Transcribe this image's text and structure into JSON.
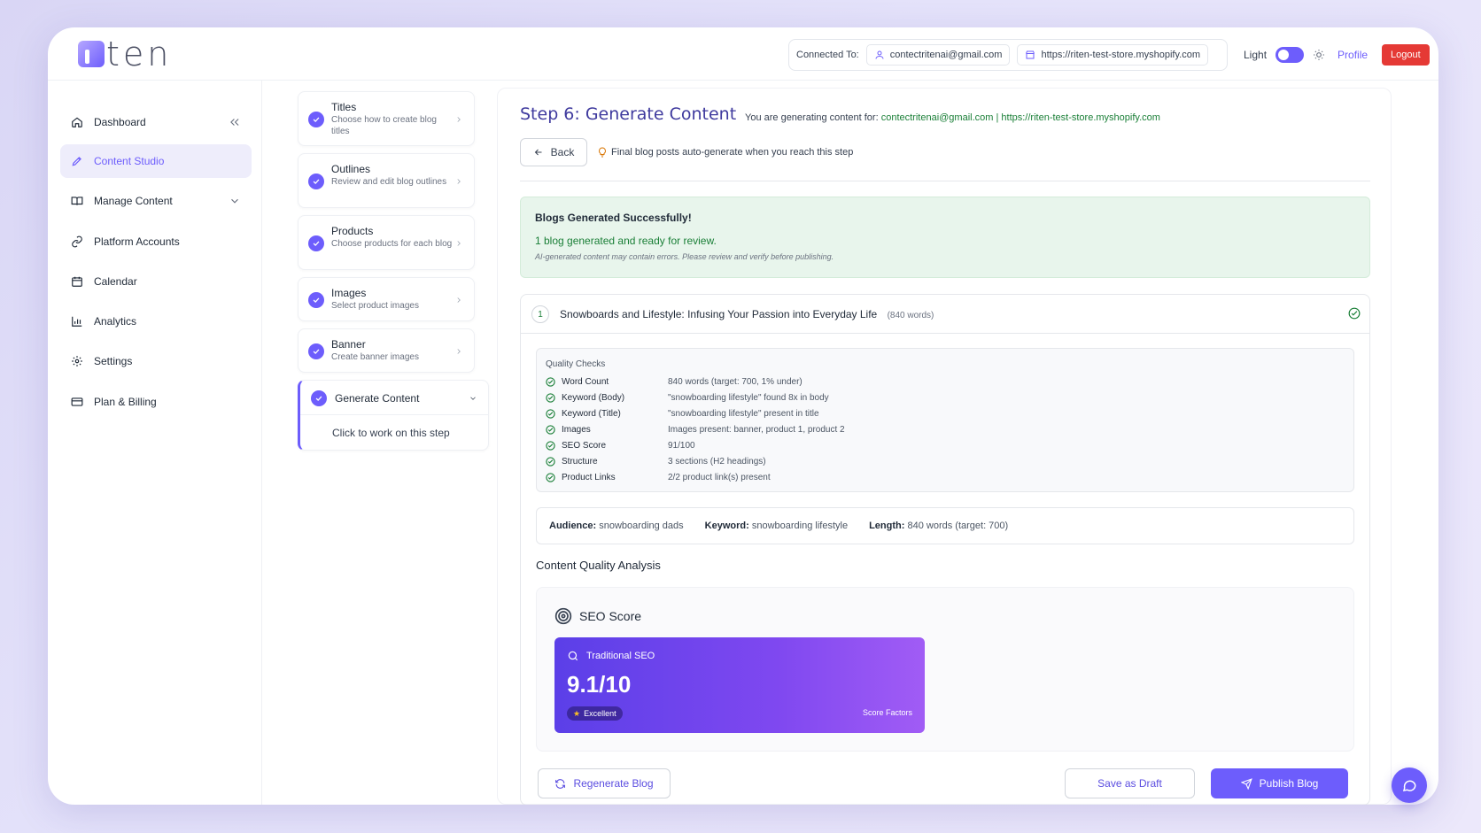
{
  "header": {
    "logo_text": "ten",
    "connected_label": "Connected To:",
    "email": "contectritenai@gmail.com",
    "store_url": "https://riten-test-store.myshopify.com",
    "theme_label": "Light",
    "profile_label": "Profile",
    "logout_label": "Logout"
  },
  "sidebar": {
    "items": [
      {
        "label": "Dashboard",
        "icon": "home-icon"
      },
      {
        "label": "Content Studio",
        "icon": "pen-icon"
      },
      {
        "label": "Manage Content",
        "icon": "book-icon"
      },
      {
        "label": "Platform Accounts",
        "icon": "link-icon"
      },
      {
        "label": "Calendar",
        "icon": "calendar-icon"
      },
      {
        "label": "Analytics",
        "icon": "chart-icon"
      },
      {
        "label": "Settings",
        "icon": "gear-icon"
      },
      {
        "label": "Plan & Billing",
        "icon": "card-icon"
      }
    ]
  },
  "steps": [
    {
      "title": "Titles",
      "desc": "Choose how to create blog titles"
    },
    {
      "title": "Outlines",
      "desc": "Review and edit blog outlines"
    },
    {
      "title": "Products",
      "desc": "Choose products for each blog"
    },
    {
      "title": "Images",
      "desc": "Select product images"
    },
    {
      "title": "Banner",
      "desc": "Create banner images"
    },
    {
      "title": "Generate Content",
      "desc": "Click to work on this step"
    }
  ],
  "main": {
    "title": "Step 6: Generate Content",
    "gen_for_prefix": "You are generating content for:",
    "gen_for_value": "contectritenai@gmail.com | https://riten-test-store.myshopify.com",
    "back_label": "Back",
    "hint": "Final blog posts auto-generate when you reach this step",
    "success_title": "Blogs Generated Successfully!",
    "success_text": "1 blog generated and ready for review.",
    "success_note": "AI-generated content may contain errors. Please review and verify before publishing.",
    "blog": {
      "number": "1",
      "title": "Snowboards and Lifestyle: Infusing Your Passion into Everyday Life",
      "words": "(840 words)"
    },
    "quality_checks_title": "Quality Checks",
    "quality_checks": [
      {
        "label": "Word Count",
        "value": "840 words (target: 700, 1% under)"
      },
      {
        "label": "Keyword (Body)",
        "value": "\"snowboarding lifestyle\" found 8x in body"
      },
      {
        "label": "Keyword (Title)",
        "value": "\"snowboarding lifestyle\" present in title"
      },
      {
        "label": "Images",
        "value": "Images present: banner, product 1, product 2"
      },
      {
        "label": "SEO Score",
        "value": "91/100"
      },
      {
        "label": "Structure",
        "value": "3 sections (H2 headings)"
      },
      {
        "label": "Product Links",
        "value": "2/2 product link(s) present"
      }
    ],
    "meta": {
      "audience_label": "Audience:",
      "audience_value": "snowboarding dads",
      "keyword_label": "Keyword:",
      "keyword_value": "snowboarding lifestyle",
      "length_label": "Length:",
      "length_value": "840 words (target: 700)"
    },
    "cqa_title": "Content Quality Analysis",
    "seo": {
      "title": "SEO Score",
      "card_title": "Traditional SEO",
      "score": "9.1/10",
      "badge": "Excellent",
      "factors": "Score Factors"
    },
    "buttons": {
      "regenerate": "Regenerate Blog",
      "draft": "Save as Draft",
      "publish": "Publish Blog"
    }
  },
  "colors": {
    "accent": "#6d5dfc",
    "success": "#1a7f37",
    "danger": "#e53935"
  }
}
